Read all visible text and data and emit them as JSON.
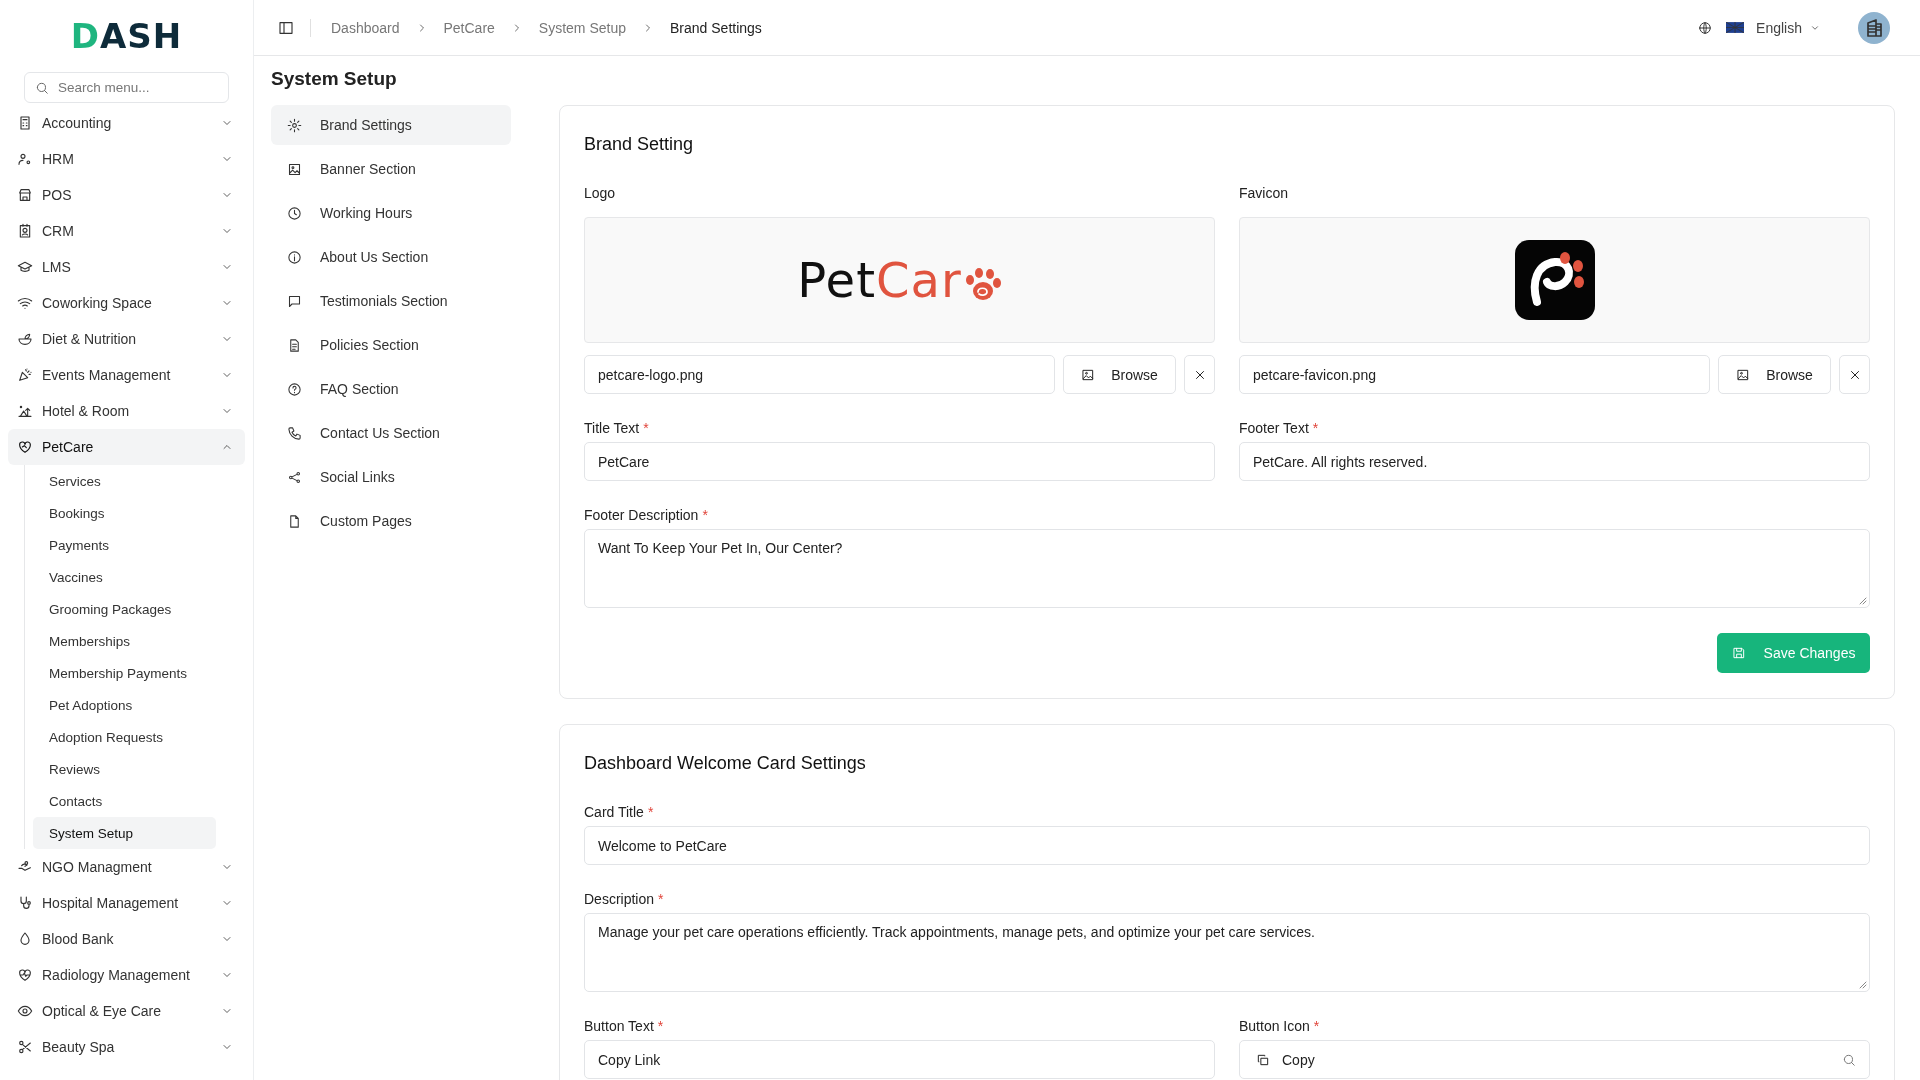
{
  "brand": {
    "logo_text": "DASH"
  },
  "search": {
    "placeholder": "Search menu..."
  },
  "menu": [
    {
      "label": "Accounting",
      "expanded": false
    },
    {
      "label": "HRM",
      "expanded": false
    },
    {
      "label": "POS",
      "expanded": false
    },
    {
      "label": "CRM",
      "expanded": false
    },
    {
      "label": "LMS",
      "expanded": false
    },
    {
      "label": "Coworking Space",
      "expanded": false
    },
    {
      "label": "Diet & Nutrition",
      "expanded": false
    },
    {
      "label": "Events Management",
      "expanded": false
    },
    {
      "label": "Hotel & Room",
      "expanded": false
    },
    {
      "label": "PetCare",
      "expanded": true,
      "children": [
        {
          "label": "Services",
          "selected": false
        },
        {
          "label": "Bookings",
          "selected": false
        },
        {
          "label": "Payments",
          "selected": false
        },
        {
          "label": "Vaccines",
          "selected": false
        },
        {
          "label": "Grooming Packages",
          "selected": false
        },
        {
          "label": "Memberships",
          "selected": false
        },
        {
          "label": "Membership Payments",
          "selected": false
        },
        {
          "label": "Pet Adoptions",
          "selected": false
        },
        {
          "label": "Adoption Requests",
          "selected": false
        },
        {
          "label": "Reviews",
          "selected": false
        },
        {
          "label": "Contacts",
          "selected": false
        },
        {
          "label": "System Setup",
          "selected": true
        }
      ]
    },
    {
      "label": "NGO Managment",
      "expanded": false
    },
    {
      "label": "Hospital Management",
      "expanded": false
    },
    {
      "label": "Blood Bank",
      "expanded": false
    },
    {
      "label": "Radiology Management",
      "expanded": false
    },
    {
      "label": "Optical & Eye Care",
      "expanded": false
    },
    {
      "label": "Beauty Spa",
      "expanded": false
    }
  ],
  "header": {
    "breadcrumbs": [
      {
        "label": "Dashboard",
        "current": false
      },
      {
        "label": "PetCare",
        "current": false
      },
      {
        "label": "System Setup",
        "current": false
      },
      {
        "label": "Brand Settings",
        "current": true
      }
    ],
    "language": "English"
  },
  "page_title": "System Setup",
  "settings_nav": [
    {
      "label": "Brand Settings",
      "selected": true
    },
    {
      "label": "Banner Section",
      "selected": false
    },
    {
      "label": "Working Hours",
      "selected": false
    },
    {
      "label": "About Us Section",
      "selected": false
    },
    {
      "label": "Testimonials Section",
      "selected": false
    },
    {
      "label": "Policies Section",
      "selected": false
    },
    {
      "label": "FAQ Section",
      "selected": false
    },
    {
      "label": "Contact Us Section",
      "selected": false
    },
    {
      "label": "Social Links",
      "selected": false
    },
    {
      "label": "Custom Pages",
      "selected": false
    }
  ],
  "brand_card": {
    "title": "Brand Setting",
    "uploads": [
      {
        "kind": "logo",
        "label": "Logo",
        "file": "petcare-logo.png",
        "browse": "Browse",
        "logo_parts": [
          {
            "text": "Pet",
            "color": "#111111"
          },
          {
            "text": "Car",
            "color": "#e0543f"
          }
        ]
      },
      {
        "kind": "favicon",
        "label": "Favicon",
        "file": "petcare-favicon.png",
        "browse": "Browse"
      }
    ],
    "fields": [
      {
        "kind": "field",
        "label": "Title Text",
        "required_mark": "*",
        "value": "PetCare"
      },
      {
        "kind": "field",
        "label": "Footer Text",
        "required_mark": "*",
        "value": "PetCare. All rights reserved."
      },
      {
        "kind": "textarea",
        "label": "Footer Description",
        "required_mark": "*",
        "value": "Want To Keep Your Pet In, Our Center?"
      }
    ],
    "save": "Save Changes"
  },
  "welcome_card": {
    "title": "Dashboard Welcome Card Settings",
    "fields": [
      {
        "kind": "widefield",
        "label": "Card Title",
        "required_mark": "*",
        "value": "Welcome to PetCare"
      },
      {
        "kind": "textarea",
        "label": "Description",
        "required_mark": "*",
        "value": "Manage your pet care operations efficiently. Track appointments, manage pets, and optimize your pet care services."
      },
      {
        "kind": "field",
        "label": "Button Text",
        "required_mark": "*",
        "value": "Copy Link"
      },
      {
        "kind": "iconselect",
        "label": "Button Icon",
        "required_mark": "*",
        "value": "Copy"
      }
    ]
  }
}
